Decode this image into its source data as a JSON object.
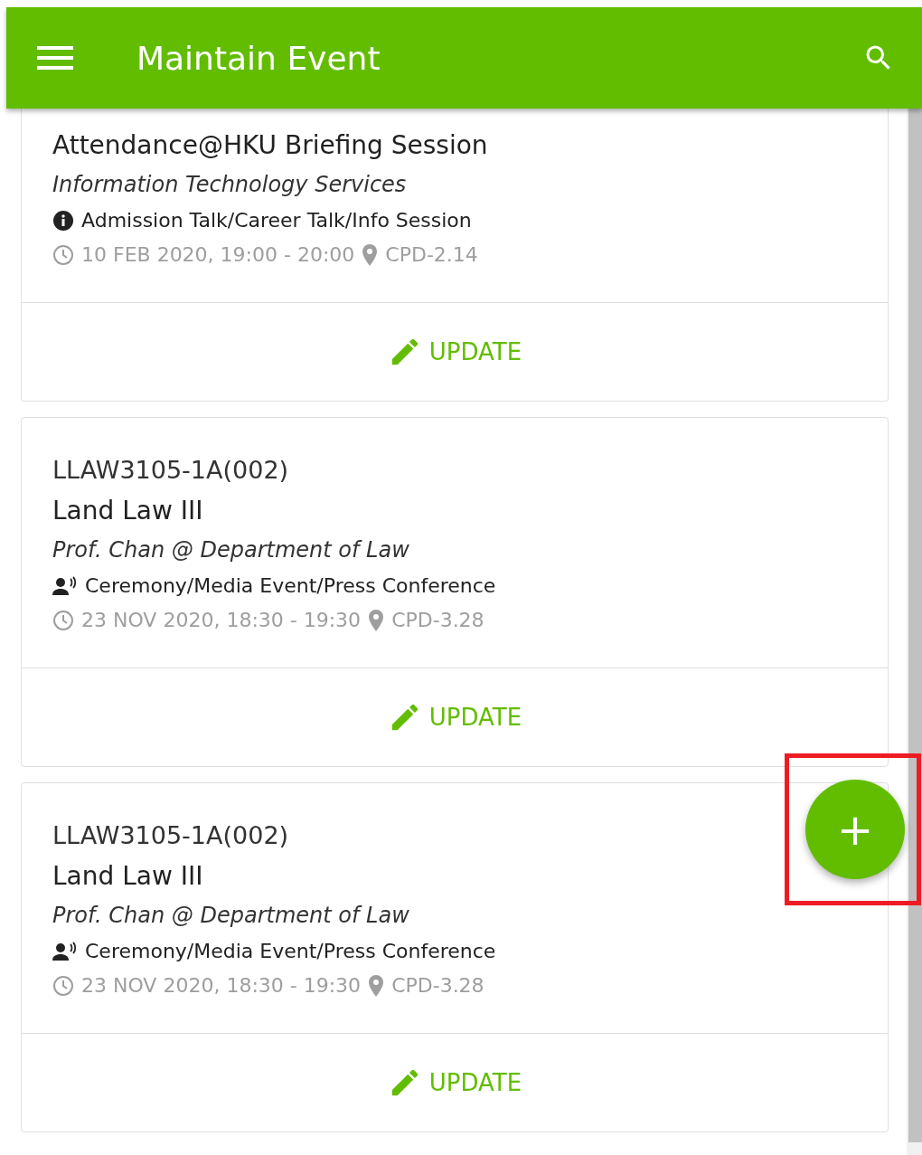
{
  "app_bar": {
    "title": "Maintain Event"
  },
  "events": [
    {
      "title": "Attendance@HKU Briefing Session",
      "organizer": "Information Technology Services",
      "category": {
        "kind": "info",
        "label": "Admission Talk/Career Talk/Info Session"
      },
      "datetime": "10 FEB 2020, 19:00 - 20:00",
      "venue": "CPD-2.14",
      "action": "UPDATE"
    },
    {
      "code": "LLAW3105-1A(002)",
      "title": "Land Law III",
      "organizer": "Prof. Chan @ Department of Law",
      "category": {
        "kind": "speaker",
        "label": "Ceremony/Media Event/Press Conference"
      },
      "datetime": "23 NOV 2020, 18:30 - 19:30",
      "venue": "CPD-3.28",
      "action": "UPDATE"
    },
    {
      "code": "LLAW3105-1A(002)",
      "title": "Land Law III",
      "organizer": "Prof. Chan @ Department of Law",
      "category": {
        "kind": "speaker",
        "label": "Ceremony/Media Event/Press Conference"
      },
      "datetime": "23 NOV 2020, 18:30 - 19:30",
      "venue": "CPD-3.28",
      "action": "UPDATE"
    }
  ],
  "add_button": {
    "label": "+",
    "highlighted": true
  }
}
